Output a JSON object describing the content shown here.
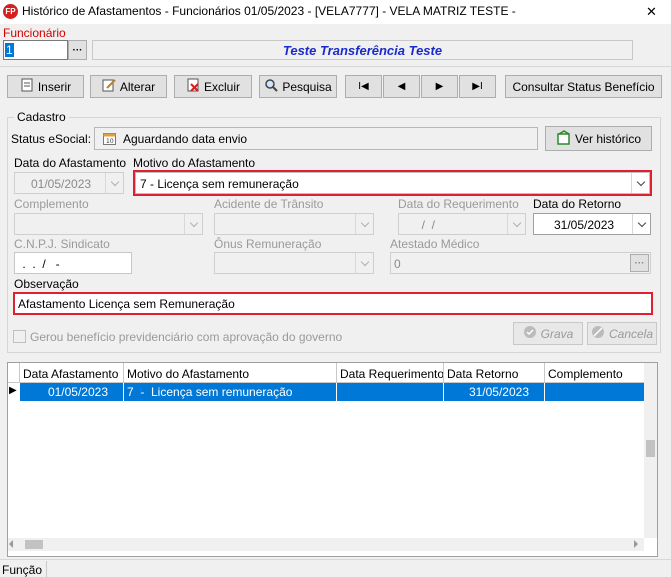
{
  "window": {
    "title": "Histórico de Afastamentos - Funcionários  01/05/2023 - [VELA7777] - VELA MATRIZ TESTE -",
    "icon_text": "FP",
    "close_glyph": "✕"
  },
  "funcionario": {
    "label": "Funcionário",
    "code": "1",
    "name": "Teste Transferência Teste",
    "lookup_glyph": "···"
  },
  "toolbar": {
    "inserir": "Inserir",
    "alterar": "Alterar",
    "excluir": "Excluir",
    "pesquisa": "Pesquisa",
    "first": "I◀",
    "prev": "◀",
    "next": "▶",
    "last": "▶I",
    "consultar": "Consultar Status Benefício"
  },
  "cadastro": {
    "group_label": "Cadastro",
    "status_label": "Status eSocial:",
    "status_value": "Aguardando data envio",
    "ver_historico": "Ver histórico",
    "data_afastamento_label": "Data do Afastamento",
    "data_afastamento_value": "01/05/2023",
    "motivo_label": "Motivo do Afastamento",
    "motivo_value": "7  -  Licença sem remuneração",
    "complemento_label": "Complemento",
    "acidente_label": "Acidente de Trânsito",
    "requerimento_label": "Data do Requerimento",
    "requerimento_value": "  /  /",
    "retorno_label": "Data do Retorno",
    "retorno_value": "31/05/2023",
    "cnpj_label": "C.N.P.J. Sindicato",
    "cnpj_value": " .  .  /   -",
    "onus_label": "Ônus Remuneração",
    "atestado_label": "Atestado Médico",
    "atestado_value": "0",
    "observacao_label": "Observação",
    "observacao_value": "Afastamento Licença sem Remuneração",
    "gerou_label": "Gerou benefício previdenciário com aprovação do governo",
    "grava": "Grava",
    "cancela": "Cancela"
  },
  "grid": {
    "columns": [
      "Data Afastamento",
      "Motivo do Afastamento",
      "Data Requerimento",
      "Data Retorno",
      "Complemento"
    ],
    "rows": [
      {
        "data_afastamento": "01/05/2023",
        "motivo": "7  -  Licença sem remuneração",
        "data_requerimento": "",
        "data_retorno": "31/05/2023",
        "complemento": ""
      }
    ],
    "row_indicator": "▶"
  },
  "statusbar": {
    "text": "Função"
  },
  "colors": {
    "accent_blue": "#1a2bcc",
    "selection": "#0078d7",
    "highlight_red": "#e02030"
  }
}
